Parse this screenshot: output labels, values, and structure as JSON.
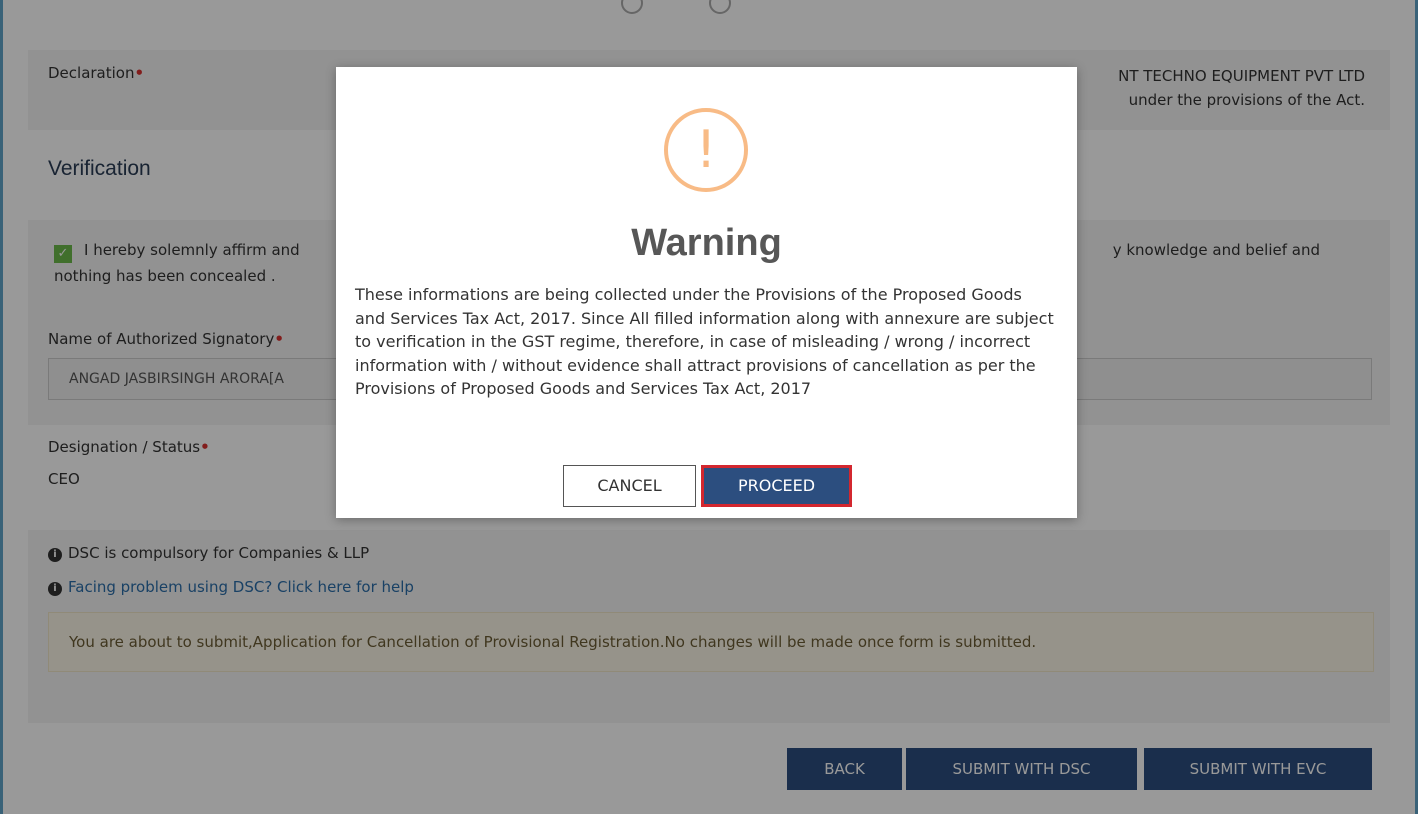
{
  "declaration": {
    "label": "Declaration",
    "text_line1": "NT TECHNO EQUIPMENT PVT LTD",
    "text_line2": "under the provisions of the Act."
  },
  "verification": {
    "title": "Verification",
    "affirm_text": "I hereby solemnly affirm and",
    "affirm_text_right": "y knowledge and belief and",
    "affirm_text_line2": "nothing has been concealed .",
    "signatory_label": "Name of Authorized Signatory",
    "signatory_value": "ANGAD JASBIRSINGH ARORA[A",
    "designation_label": "Designation / Status",
    "designation_value": "CEO"
  },
  "dsc": {
    "info1": "DSC is compulsory for Companies & LLP",
    "info2": "Facing problem using DSC? Click here for help",
    "notice": "You are about to submit,Application for Cancellation of Provisional Registration.No changes will be made once form is submitted."
  },
  "buttons": {
    "back": "BACK",
    "submit_dsc": "SUBMIT WITH DSC",
    "submit_evc": "SUBMIT WITH EVC"
  },
  "modal": {
    "icon_glyph": "!",
    "title": "Warning",
    "body": "These informations are being collected under the Provisions of the Proposed Goods and Services Tax Act, 2017. Since All filled information along with annexure are subject to verification in the GST regime, therefore, in case of misleading / wrong / incorrect information with / without evidence shall attract provisions of cancellation as per the Provisions of Proposed Goods and Services Tax Act, 2017",
    "cancel": "CANCEL",
    "proceed": "PROCEED"
  },
  "colors": {
    "primary_button": "#2c4e7f",
    "highlight_border": "#d3272f",
    "warning_icon": "#f8bb86",
    "required_mark": "#d9312f"
  }
}
